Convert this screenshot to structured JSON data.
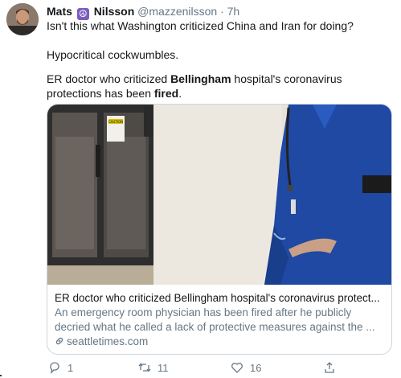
{
  "tweet": {
    "name": "Mats",
    "name_suffix": "Nilsson",
    "handle": "@mazzenilsson",
    "separator": "·",
    "time": "7h",
    "line1": "Isn't this what Washington criticized China and Iran for doing?",
    "line2": "Hypocritical cockwumbles.",
    "line3_a": "ER doctor who criticized ",
    "line3_bold": "Bellingham",
    "line3_b": " hospital's coronavirus",
    "line4_a": "protections has been ",
    "line4_bold": "fired",
    "line4_b": "."
  },
  "card": {
    "title": "ER doctor who criticized Bellingham hospital's coronavirus protect...",
    "desc1": "An emergency room physician has been fired after he publicly",
    "desc2": "decried what he called a lack of protective measures against the ...",
    "domain": "seattletimes.com",
    "sign_caution": "CAUTION"
  },
  "actions": {
    "reply_count": "1",
    "retweet_count": "11",
    "like_count": "16"
  },
  "icons": [
    "peace-symbol-icon",
    "link-icon",
    "reply-icon",
    "retweet-icon",
    "like-icon",
    "share-icon"
  ]
}
